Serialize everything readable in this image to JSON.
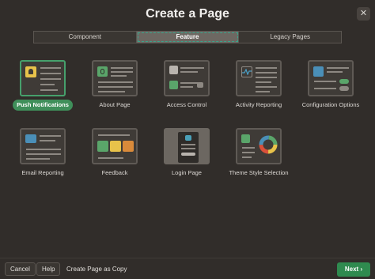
{
  "dialog": {
    "title": "Create a Page",
    "close_icon": "✕"
  },
  "tabs": [
    {
      "label": "Component",
      "active": false
    },
    {
      "label": "Feature",
      "active": true
    },
    {
      "label": "Legacy Pages",
      "active": false
    }
  ],
  "tiles": [
    {
      "label": "Push Notifications",
      "selected": true,
      "icon": "bell-icon"
    },
    {
      "label": "About Page",
      "selected": false,
      "icon": "info-icon"
    },
    {
      "label": "Access Control",
      "selected": false,
      "icon": "users-lock-icon"
    },
    {
      "label": "Activity Reporting",
      "selected": false,
      "icon": "activity-icon"
    },
    {
      "label": "Configuration Options",
      "selected": false,
      "icon": "toggles-icon"
    },
    {
      "label": "Email Reporting",
      "selected": false,
      "icon": "envelope-icon"
    },
    {
      "label": "Feedback",
      "selected": false,
      "icon": "smiley-faces-icon"
    },
    {
      "label": "Login Page",
      "selected": false,
      "icon": "login-form-icon"
    },
    {
      "label": "Theme Style Selection",
      "selected": false,
      "icon": "palette-wheel-icon"
    }
  ],
  "footer": {
    "cancel_label": "Cancel",
    "help_label": "Help",
    "copy_label": "Create Page as Copy",
    "next_label": "Next",
    "next_icon": "›"
  },
  "colors": {
    "accent_green": "#46a06c",
    "next_button": "#2f8a4f",
    "background": "#312d2a"
  }
}
